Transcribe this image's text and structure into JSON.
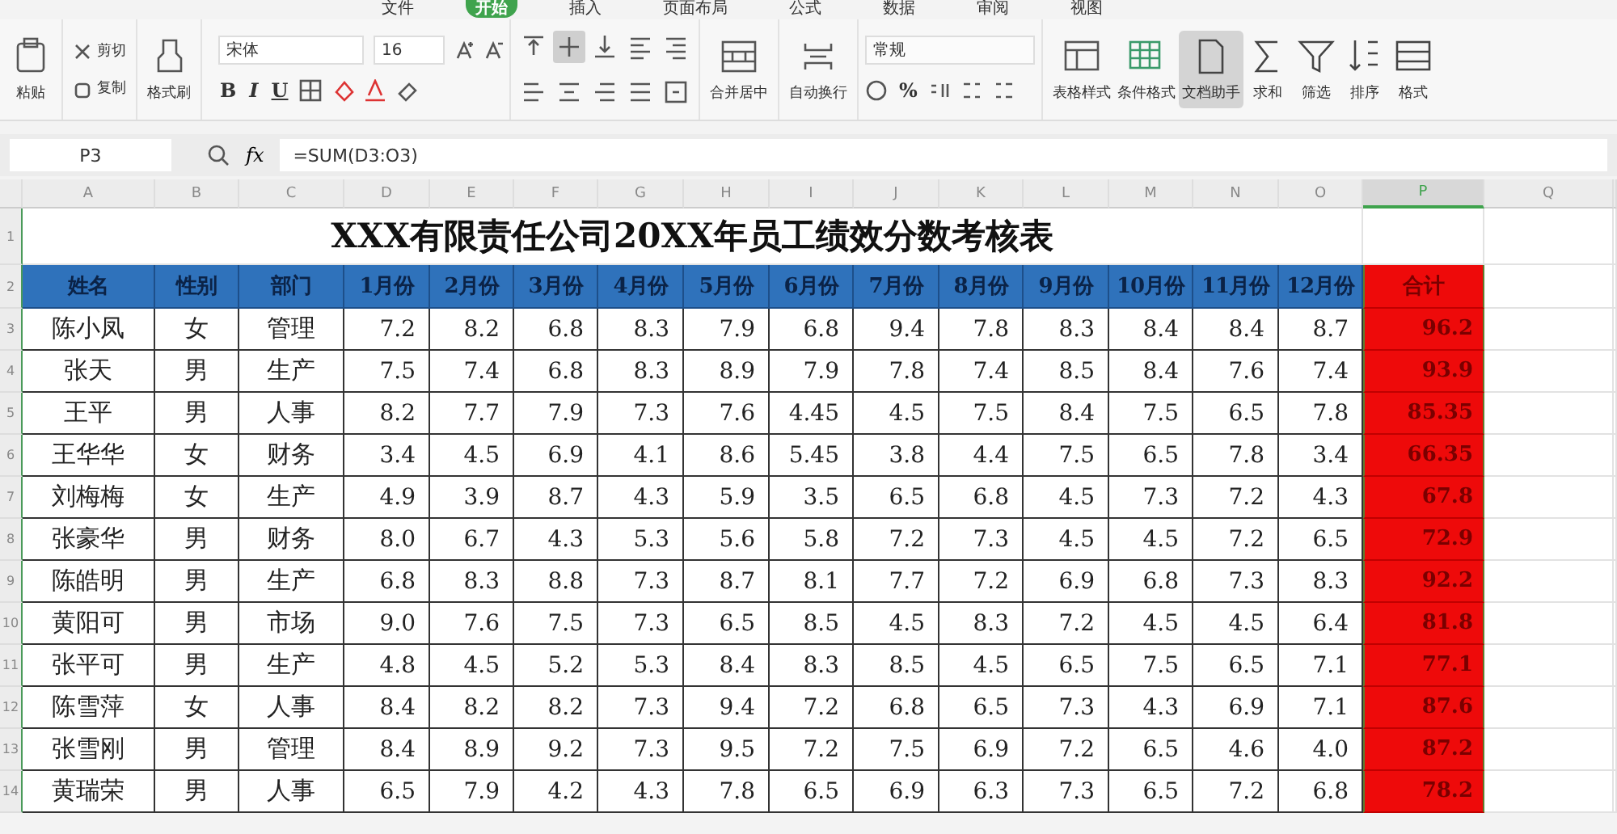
{
  "menu_tabs": [
    {
      "label": "文件",
      "selected": false
    },
    {
      "label": "开始",
      "selected": true
    },
    {
      "label": "插入",
      "selected": false
    },
    {
      "label": "页面布局",
      "selected": false
    },
    {
      "label": "公式",
      "selected": false
    },
    {
      "label": "数据",
      "selected": false
    },
    {
      "label": "审阅",
      "selected": false
    },
    {
      "label": "视图",
      "selected": false
    }
  ],
  "ribbon": {
    "groups": [
      {
        "kind": "large",
        "label": "粘贴"
      },
      {
        "kind": "pair",
        "items": [
          "剪切",
          "复制"
        ]
      },
      {
        "kind": "large",
        "label": "格式刷"
      },
      {
        "kind": "font",
        "font_name": "宋体",
        "font_size": "16",
        "buttons": [
          "B",
          "I",
          "U"
        ]
      },
      {
        "kind": "align",
        "buttons": [
          {
            "pressed": false
          },
          {
            "pressed": true
          },
          {
            "pressed": false
          },
          {
            "pressed": false
          },
          {
            "pressed": false
          },
          {
            "pressed": false
          },
          {
            "pressed": false
          },
          {
            "pressed": false
          },
          {
            "pressed": false
          },
          {
            "pressed": false
          }
        ]
      },
      {
        "kind": "large",
        "label": "合并居中"
      },
      {
        "kind": "large",
        "label": "自动换行"
      },
      {
        "kind": "number",
        "format": "常规",
        "buttons": [
          "%"
        ]
      },
      {
        "kind": "tools",
        "items": [
          {
            "label": "表格样式",
            "pressed": false
          },
          {
            "label": "条件格式",
            "pressed": false
          },
          {
            "label": "文档助手",
            "pressed": true
          },
          {
            "label": "求和",
            "pressed": false
          },
          {
            "label": "筛选",
            "pressed": false
          },
          {
            "label": "排序",
            "pressed": false
          },
          {
            "label": "格式",
            "pressed": false
          }
        ]
      }
    ]
  },
  "formula_bar": {
    "name_box": "P3",
    "fx": "fx",
    "formula": "=SUM(D3:O3)"
  },
  "sheet": {
    "columns": [
      {
        "label": "A",
        "selected": false
      },
      {
        "label": "B",
        "selected": false
      },
      {
        "label": "C",
        "selected": false
      },
      {
        "label": "D",
        "selected": false
      },
      {
        "label": "E",
        "selected": false
      },
      {
        "label": "F",
        "selected": false
      },
      {
        "label": "G",
        "selected": false
      },
      {
        "label": "H",
        "selected": false
      },
      {
        "label": "I",
        "selected": false
      },
      {
        "label": "J",
        "selected": false
      },
      {
        "label": "K",
        "selected": false
      },
      {
        "label": "L",
        "selected": false
      },
      {
        "label": "M",
        "selected": false
      },
      {
        "label": "N",
        "selected": false
      },
      {
        "label": "O",
        "selected": false
      },
      {
        "label": "P",
        "selected": true
      },
      {
        "label": "Q",
        "selected": false
      }
    ],
    "title_row": "1",
    "title": "XXX有限责任公司20XX年员工绩效分数考核表",
    "header_row": "2",
    "headers": [
      "姓名",
      "性别",
      "部门",
      "1月份",
      "2月份",
      "3月份",
      "4月份",
      "5月份",
      "6月份",
      "7月份",
      "8月份",
      "9月份",
      "10月份",
      "11月份",
      "12月份"
    ],
    "total_header": "合计",
    "rows": [
      {
        "row": "3",
        "cells": [
          "陈小凤",
          "女",
          "管理",
          "7.2",
          "8.2",
          "6.8",
          "8.3",
          "7.9",
          "6.8",
          "9.4",
          "7.8",
          "8.3",
          "8.4",
          "8.4",
          "8.7"
        ],
        "total": "96.2"
      },
      {
        "row": "4",
        "cells": [
          "张天",
          "男",
          "生产",
          "7.5",
          "7.4",
          "6.8",
          "8.3",
          "8.9",
          "7.9",
          "7.8",
          "7.4",
          "8.5",
          "8.4",
          "7.6",
          "7.4"
        ],
        "total": "93.9"
      },
      {
        "row": "5",
        "cells": [
          "王平",
          "男",
          "人事",
          "8.2",
          "7.7",
          "7.9",
          "7.3",
          "7.6",
          "4.45",
          "4.5",
          "7.5",
          "8.4",
          "7.5",
          "6.5",
          "7.8"
        ],
        "total": "85.35"
      },
      {
        "row": "6",
        "cells": [
          "王华华",
          "女",
          "财务",
          "3.4",
          "4.5",
          "6.9",
          "4.1",
          "8.6",
          "5.45",
          "3.8",
          "4.4",
          "7.5",
          "6.5",
          "7.8",
          "3.4"
        ],
        "total": "66.35"
      },
      {
        "row": "7",
        "cells": [
          "刘梅梅",
          "女",
          "生产",
          "4.9",
          "3.9",
          "8.7",
          "4.3",
          "5.9",
          "3.5",
          "6.5",
          "6.8",
          "4.5",
          "7.3",
          "7.2",
          "4.3"
        ],
        "total": "67.8"
      },
      {
        "row": "8",
        "cells": [
          "张豪华",
          "男",
          "财务",
          "8.0",
          "6.7",
          "4.3",
          "5.3",
          "5.6",
          "5.8",
          "7.2",
          "7.3",
          "4.5",
          "4.5",
          "7.2",
          "6.5"
        ],
        "total": "72.9"
      },
      {
        "row": "9",
        "cells": [
          "陈皓明",
          "男",
          "生产",
          "6.8",
          "8.3",
          "8.8",
          "7.3",
          "8.7",
          "8.1",
          "7.7",
          "7.2",
          "6.9",
          "6.8",
          "7.3",
          "8.3"
        ],
        "total": "92.2"
      },
      {
        "row": "10",
        "cells": [
          "黄阳可",
          "男",
          "市场",
          "9.0",
          "7.6",
          "7.5",
          "7.3",
          "6.5",
          "8.5",
          "4.5",
          "8.3",
          "7.2",
          "4.5",
          "4.5",
          "6.4"
        ],
        "total": "81.8"
      },
      {
        "row": "11",
        "cells": [
          "张平可",
          "男",
          "生产",
          "4.8",
          "4.5",
          "5.2",
          "5.3",
          "8.4",
          "8.3",
          "8.5",
          "4.5",
          "6.5",
          "7.5",
          "6.5",
          "7.1"
        ],
        "total": "77.1"
      },
      {
        "row": "12",
        "cells": [
          "陈雪萍",
          "女",
          "人事",
          "8.4",
          "8.2",
          "8.2",
          "7.3",
          "9.4",
          "7.2",
          "6.8",
          "6.5",
          "7.3",
          "4.3",
          "6.9",
          "7.1"
        ],
        "total": "87.6"
      },
      {
        "row": "13",
        "cells": [
          "张雪刚",
          "男",
          "管理",
          "8.4",
          "8.9",
          "9.2",
          "7.3",
          "9.5",
          "7.2",
          "7.5",
          "6.9",
          "7.2",
          "6.5",
          "4.6",
          "4.0"
        ],
        "total": "87.2"
      },
      {
        "row": "14",
        "cells": [
          "黄瑞荣",
          "男",
          "人事",
          "6.5",
          "7.9",
          "4.2",
          "4.3",
          "7.8",
          "6.5",
          "6.9",
          "6.3",
          "7.3",
          "6.5",
          "7.2",
          "6.8"
        ],
        "total": "78.2"
      }
    ]
  }
}
